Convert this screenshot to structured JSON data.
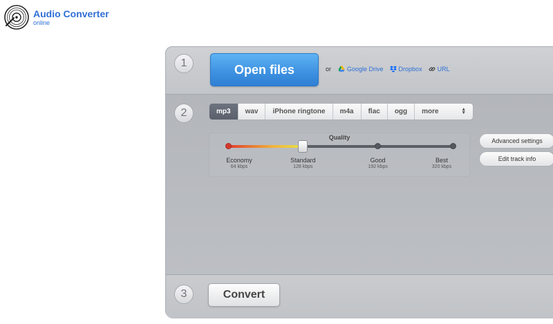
{
  "brand": {
    "title": "Audio Converter",
    "subtitle": "online"
  },
  "step1": {
    "number": "1",
    "open_label": "Open files",
    "or_label": "or",
    "sources": [
      {
        "label": "Google Drive",
        "icon": "google-drive-icon"
      },
      {
        "label": "Dropbox",
        "icon": "dropbox-icon"
      },
      {
        "label": "URL",
        "icon": "link-icon"
      }
    ]
  },
  "step2": {
    "number": "2",
    "formats": [
      "mp3",
      "wav",
      "iPhone ringtone",
      "m4a",
      "flac",
      "ogg",
      "more"
    ],
    "selected_format": "mp3",
    "quality": {
      "label": "Quality",
      "selected_index": 1,
      "options": [
        {
          "name": "Economy",
          "kbps": "64 kbps"
        },
        {
          "name": "Standard",
          "kbps": "128 kbps"
        },
        {
          "name": "Good",
          "kbps": "192 kbps"
        },
        {
          "name": "Best",
          "kbps": "320 kbps"
        }
      ]
    },
    "advanced_label": "Advanced settings",
    "edit_info_label": "Edit track info"
  },
  "step3": {
    "number": "3",
    "convert_label": "Convert"
  },
  "colors": {
    "accent": "#2f6fd6",
    "button_blue": "#3f93e2",
    "panel": "#b9bcc1"
  }
}
